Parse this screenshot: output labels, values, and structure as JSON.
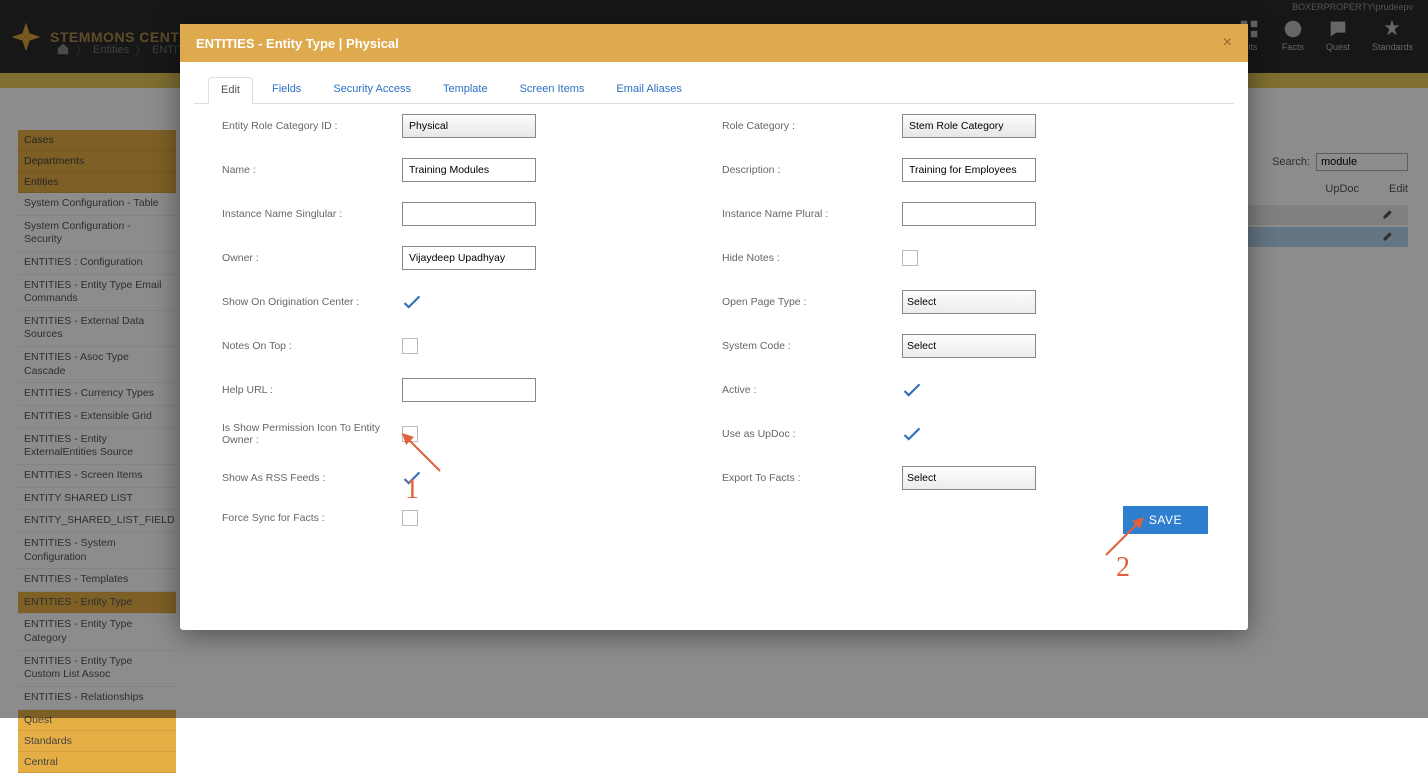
{
  "brand": {
    "name": "STEMMONS CENTRAL",
    "user": "BOXERPROPERTY\\prudeepv"
  },
  "top_nav": {
    "items": [
      "ents",
      "Facts",
      "Quest",
      "Standards"
    ]
  },
  "breadcrumb": {
    "root": "Entities",
    "current": "ENTITIES"
  },
  "sidebar": {
    "groups": [
      {
        "label": "Cases",
        "type": "head"
      },
      {
        "label": "Departments",
        "type": "head"
      },
      {
        "label": "Entities",
        "type": "head"
      },
      {
        "label": "System Configuration - Table",
        "type": "sub"
      },
      {
        "label": "System Configuration - Security",
        "type": "sub"
      },
      {
        "label": "ENTITIES : Configuration",
        "type": "sub"
      },
      {
        "label": "ENTITIES - Entity Type Email Commands",
        "type": "sub"
      },
      {
        "label": "ENTITIES - External Data Sources",
        "type": "sub"
      },
      {
        "label": "ENTITIES - Asoc Type Cascade",
        "type": "sub"
      },
      {
        "label": "ENTITIES - Currency Types",
        "type": "sub"
      },
      {
        "label": "ENTITIES - Extensible Grid",
        "type": "sub"
      },
      {
        "label": "ENTITIES - Entity ExternalEntities Source",
        "type": "sub"
      },
      {
        "label": "ENTITIES - Screen Items",
        "type": "sub"
      },
      {
        "label": "ENTITY SHARED LIST",
        "type": "sub"
      },
      {
        "label": "ENTITY_SHARED_LIST_FIELD",
        "type": "sub"
      },
      {
        "label": "ENTITIES - System Configuration",
        "type": "sub"
      },
      {
        "label": "ENTITIES - Templates",
        "type": "sub"
      },
      {
        "label": "ENTITIES - Entity Type",
        "type": "sub",
        "active": true
      },
      {
        "label": "ENTITIES - Entity Type Category",
        "type": "sub"
      },
      {
        "label": "ENTITIES - Entity Type Custom List Assoc",
        "type": "sub"
      },
      {
        "label": "ENTITIES - Relationships",
        "type": "sub"
      },
      {
        "label": "Quest",
        "type": "head"
      },
      {
        "label": "Standards",
        "type": "head"
      },
      {
        "label": "Central",
        "type": "head"
      }
    ]
  },
  "search": {
    "label": "Search:",
    "value": "module"
  },
  "table_peek": {
    "th_updoc": "UpDoc",
    "th_edit": "Edit"
  },
  "modal": {
    "title": "ENTITIES - Entity Type | Physical",
    "tabs": [
      "Edit",
      "Fields",
      "Security Access",
      "Template",
      "Screen Items",
      "Email Aliases"
    ],
    "active_tab": 0,
    "form": {
      "entity_role_category_id": {
        "label": "Entity Role Category ID :",
        "value": "Physical"
      },
      "role_category": {
        "label": "Role Category :",
        "value": "Stem Role Category"
      },
      "name": {
        "label": "Name :",
        "value": "Training Modules"
      },
      "description": {
        "label": "Description :",
        "value": "Training for Employees"
      },
      "instance_singular": {
        "label": "Instance Name Singlular :",
        "value": ""
      },
      "instance_plural": {
        "label": "Instance Name Plural :",
        "value": ""
      },
      "owner": {
        "label": "Owner :",
        "value": "Vijaydeep Upadhyay"
      },
      "hide_notes": {
        "label": "Hide Notes :",
        "checked": false
      },
      "show_origination": {
        "label": "Show On Origination Center :",
        "checked": true
      },
      "open_page_type": {
        "label": "Open Page Type :",
        "value": "Select"
      },
      "notes_on_top": {
        "label": "Notes On Top :",
        "checked": false
      },
      "system_code": {
        "label": "System Code :",
        "value": "Select"
      },
      "help_url": {
        "label": "Help URL :",
        "value": ""
      },
      "active": {
        "label": "Active :",
        "checked": true
      },
      "is_show_permission": {
        "label": "Is Show Permission Icon To Entity Owner :",
        "checked": false
      },
      "use_as_updoc": {
        "label": "Use as UpDoc :",
        "checked": true
      },
      "show_rss": {
        "label": "Show As RSS Feeds :",
        "checked": true
      },
      "export_facts": {
        "label": "Export To Facts :",
        "value": "Select"
      },
      "force_sync": {
        "label": "Force Sync for Facts :",
        "checked": false
      }
    },
    "save_label": "SAVE"
  },
  "annotations": {
    "n1": "1",
    "n2": "2"
  }
}
